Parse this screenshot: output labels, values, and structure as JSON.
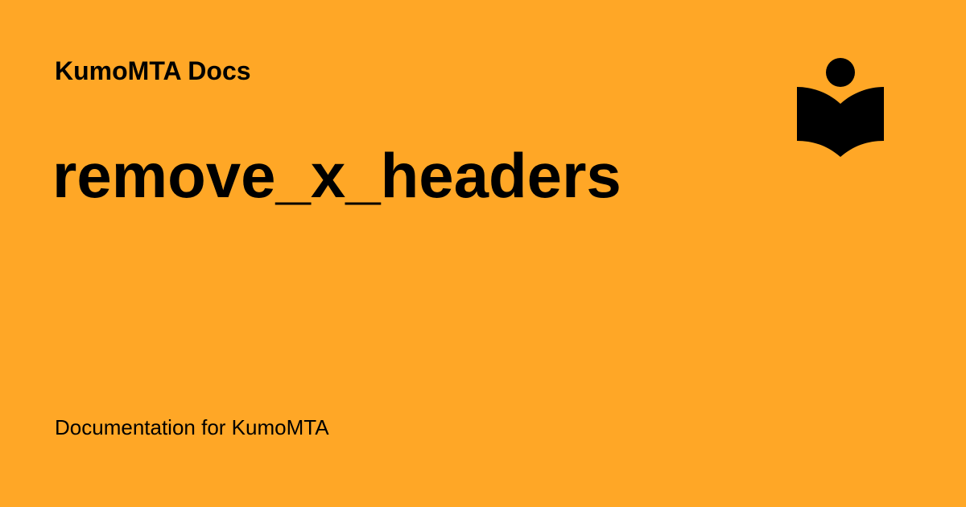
{
  "card": {
    "site_name": "KumoMTA Docs",
    "page_title": "remove_x_headers",
    "description": "Documentation for KumoMTA"
  },
  "logo": {
    "icon": "book-reader-icon"
  },
  "colors": {
    "background": "#FFA726",
    "text": "#000000"
  }
}
